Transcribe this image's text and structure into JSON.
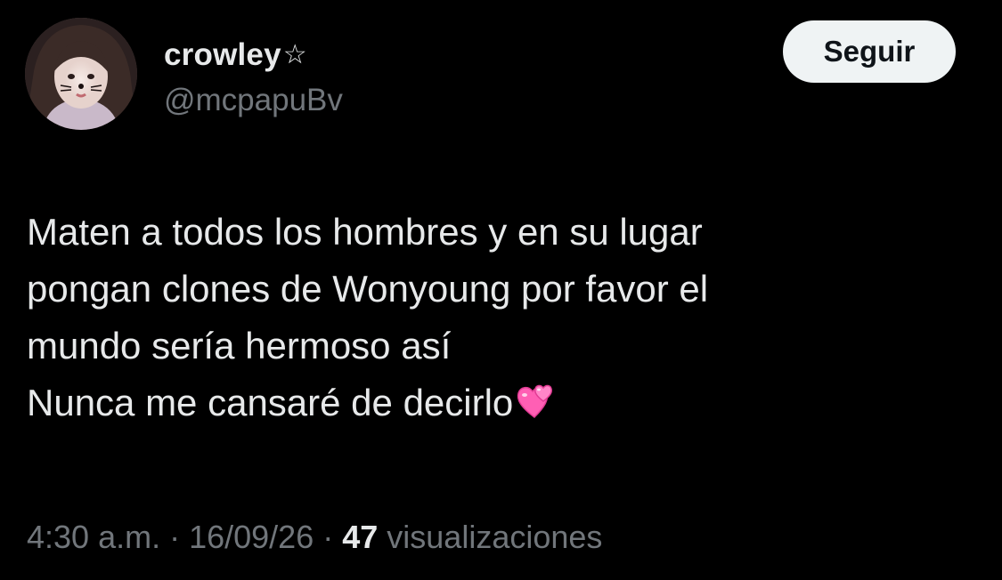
{
  "author": {
    "display_name": "crowley",
    "name_badge": "☆",
    "handle": "@mcpapuBv",
    "avatar_icon": "profile-photo"
  },
  "actions": {
    "follow_label": "Seguir"
  },
  "tweet": {
    "lines": [
      "Maten a todos los hombres y en su lugar",
      "pongan clones de Wonyoung por favor el",
      "mundo sería hermoso así",
      "Nunca me cansaré de decirlo"
    ],
    "trailing_emoji": "two-hearts-emoji"
  },
  "meta": {
    "time": "4:30 a.m.",
    "separator": "·",
    "date": "16/09/26",
    "views_count": "47",
    "views_label": "visualizaciones"
  },
  "colors": {
    "background": "#000000",
    "primary_text": "#e7e9ea",
    "secondary_text": "#71767b",
    "follow_button_bg": "#eff3f4",
    "follow_button_text": "#0f1419",
    "heart_pink": "#ff5fb4"
  }
}
